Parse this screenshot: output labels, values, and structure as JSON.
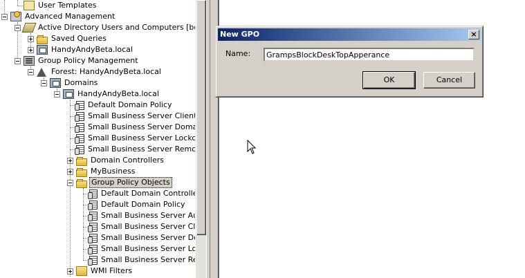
{
  "tree": {
    "items": [
      {
        "label": "User Templates",
        "icon": "template-icon"
      },
      {
        "label": "Advanced Management",
        "icon": "management-icon"
      },
      {
        "label": "Active Directory Users and Computers [bobcatr",
        "icon": "ad-icon"
      },
      {
        "label": "Saved Queries",
        "icon": "folder-icon"
      },
      {
        "label": "HandyAndyBeta.local",
        "icon": "domain-icon"
      },
      {
        "label": "Group Policy Management",
        "icon": "gpm-icon"
      },
      {
        "label": "Forest: HandyAndyBeta.local",
        "icon": "forest-icon"
      },
      {
        "label": "Domains",
        "icon": "domains-icon"
      },
      {
        "label": "HandyAndyBeta.local",
        "icon": "domain-icon"
      },
      {
        "label": "Default Domain Policy",
        "icon": "gpo-link-icon"
      },
      {
        "label": "Small Business Server Client Cor",
        "icon": "gpo-link-icon"
      },
      {
        "label": "Small Business Server Domain P",
        "icon": "gpo-link-icon"
      },
      {
        "label": "Small Business Server Lockout F",
        "icon": "gpo-link-icon"
      },
      {
        "label": "Small Business Server Remote A",
        "icon": "gpo-link-icon"
      },
      {
        "label": "Domain Controllers",
        "icon": "ou-icon"
      },
      {
        "label": "MyBusiness",
        "icon": "ou-icon"
      },
      {
        "label": "Group Policy Objects",
        "icon": "gpo-folder-icon"
      },
      {
        "label": "Default Domain Controllers",
        "icon": "gpo-icon"
      },
      {
        "label": "Default Domain Policy",
        "icon": "gpo-icon"
      },
      {
        "label": "Small Business Server Audit",
        "icon": "gpo-icon"
      },
      {
        "label": "Small Business Server Client",
        "icon": "gpo-icon"
      },
      {
        "label": "Small Business Server Doma",
        "icon": "gpo-icon"
      },
      {
        "label": "Small Business Server Locko",
        "icon": "gpo-icon"
      },
      {
        "label": "Small Business Server Remo",
        "icon": "gpo-icon"
      },
      {
        "label": "WMI Filters",
        "icon": "wmi-folder-icon"
      }
    ]
  },
  "dialog": {
    "title": "New GPO",
    "close_glyph": "×",
    "name_label": "Name:",
    "name_value": "GrampsBlockDeskTopApperance",
    "ok_label": "OK",
    "cancel_label": "Cancel"
  },
  "colors": {
    "titlebar_start": "#0a246a",
    "titlebar_end": "#a6caf0",
    "face": "#d4d0c8"
  }
}
